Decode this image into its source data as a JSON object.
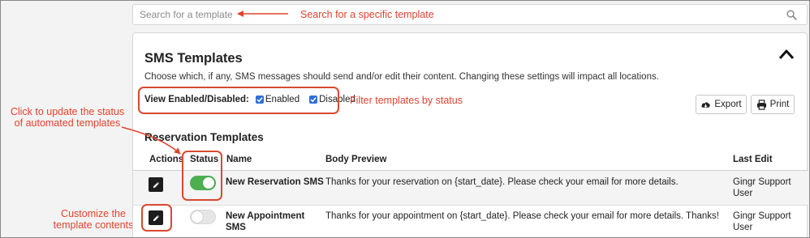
{
  "search": {
    "placeholder": "Search for a template"
  },
  "annotations": {
    "search": "Search for a specific template",
    "filter": "Filter templates by status",
    "status_line1": "Click to update the status",
    "status_line2": "of automated templates",
    "edit_line1": "Customize the",
    "edit_line2": "template contents"
  },
  "card": {
    "title": "SMS Templates",
    "description": "Choose which, if any, SMS messages should send and/or edit their content. Changing these settings will impact all locations.",
    "filter_label": "View Enabled/Disabled:",
    "filter_enabled": "Enabled",
    "filter_disabled": "Disabled",
    "export_label": "Export",
    "print_label": "Print",
    "section_title": "Reservation Templates"
  },
  "table": {
    "headers": [
      "Actions",
      "Status",
      "Name",
      "Body Preview",
      "Last Edit"
    ],
    "rows": [
      {
        "status": "on",
        "name": "New Reservation SMS",
        "body": "Thanks for your reservation on {start_date}. Please check your email for more details.",
        "last_edit_1": "Gingr Support",
        "last_edit_2": "User"
      },
      {
        "status": "off",
        "name_1": "New Appointment",
        "name_2": "SMS",
        "body": "Thanks for your appointment on {start_date}. Please check your email for more details. Thanks!",
        "last_edit_1": "Gingr Support",
        "last_edit_2": "User"
      }
    ]
  },
  "colors": {
    "annotation": "#e0432e",
    "toggle_on": "#4caf50",
    "checkbox": "#2f6fd6"
  },
  "icons": [
    "search-icon",
    "chevron-up-icon",
    "checkbox-checked-icon",
    "cloud-download-icon",
    "printer-icon",
    "pencil-icon"
  ]
}
